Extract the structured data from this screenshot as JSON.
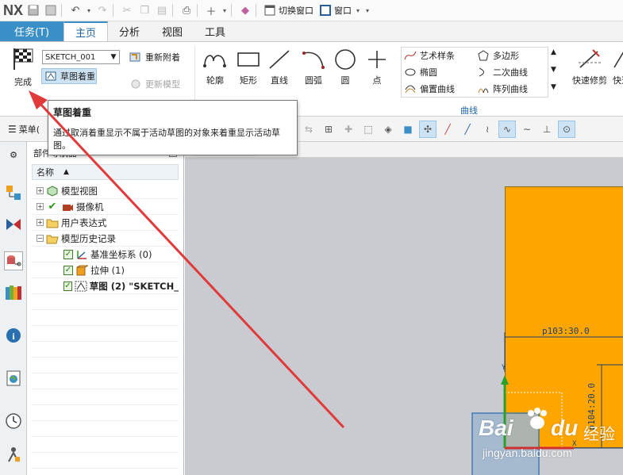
{
  "app": {
    "logo": "NX"
  },
  "quick_access": {
    "switch_window_label": "切换窗口",
    "window_label": "窗口"
  },
  "tabs": [
    {
      "label": "任务(T)"
    },
    {
      "label": "主页"
    },
    {
      "label": "分析"
    },
    {
      "label": "视图"
    },
    {
      "label": "工具"
    }
  ],
  "ribbon": {
    "finish_label": "完成",
    "sketch_select_value": "SKETCH_001",
    "reorient_label": "草图着重",
    "reattach_label": "重新附着",
    "update_model_label": "更新模型",
    "tools": [
      {
        "label": "轮廓"
      },
      {
        "label": "矩形"
      },
      {
        "label": "直线"
      },
      {
        "label": "圆弧"
      },
      {
        "label": "圆"
      },
      {
        "label": "点"
      }
    ],
    "curve_items": [
      {
        "label": "艺术样条"
      },
      {
        "label": "多边形"
      },
      {
        "label": "椭圆"
      },
      {
        "label": "二次曲线"
      },
      {
        "label": "偏置曲线"
      },
      {
        "label": "阵列曲线"
      }
    ],
    "curve_group_label": "曲线",
    "quick_trim_label": "快速修剪",
    "quick_extend_label": "快速"
  },
  "tooltip": {
    "title": "草图着重",
    "body": "通过取消着重显示不属于活动草图的对象来着重显示活动草图。"
  },
  "toolbar2": {
    "menu_label": "菜单("
  },
  "navigator": {
    "title": "部件导航器",
    "column_name": "名称",
    "items": [
      {
        "label": "模型视图"
      },
      {
        "label": "摄像机"
      },
      {
        "label": "用户表达式"
      },
      {
        "label": "模型历史记录"
      },
      {
        "label": "基准坐标系 (0)"
      },
      {
        "label": "拉伸 (1)"
      },
      {
        "label": "草图 (2) \"SKETCH_"
      }
    ]
  },
  "graphics": {
    "dim_horizontal": "p103:30.0",
    "dim_vertical": "p104:20.0",
    "axis_y": "Y",
    "axis_x": "X"
  },
  "watermark": {
    "brand": "Bai",
    "brand2": "du",
    "chinese": "经验",
    "url": "jingyan.baidu.com"
  },
  "colors": {
    "accent": "#3a8fc6",
    "part_fill": "#ffa500",
    "arrow": "#e03a3a"
  }
}
